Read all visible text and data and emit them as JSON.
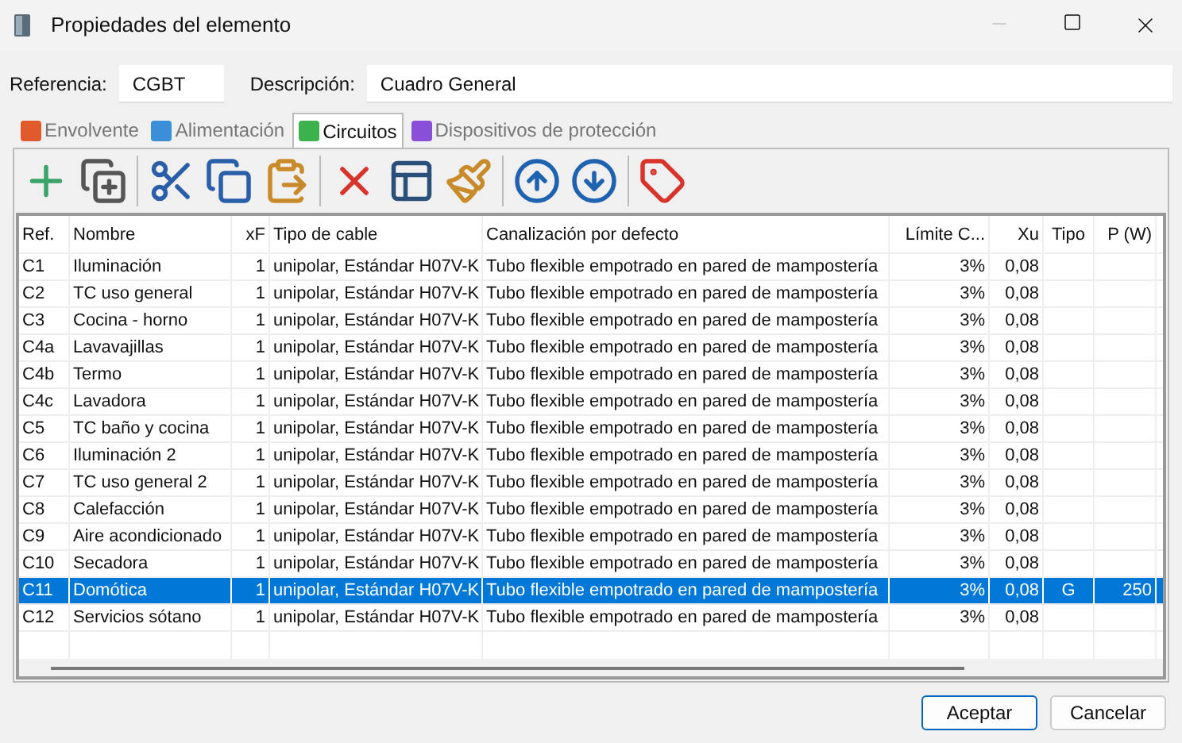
{
  "window": {
    "title": "Propiedades del elemento"
  },
  "fields": [
    {
      "label": "Referencia:",
      "value": "CGBT"
    },
    {
      "label": "Descripción:",
      "value": "Cuadro General"
    }
  ],
  "tabs": [
    {
      "label": "Envolvente",
      "selected": false,
      "color": "#e05a2b"
    },
    {
      "label": "Alimentación",
      "selected": false,
      "color": "#3a8fd8"
    },
    {
      "label": "Circuitos",
      "selected": true,
      "color": "#3cb34a"
    },
    {
      "label": "Dispositivos de protección",
      "selected": false,
      "color": "#8a4fd8"
    }
  ],
  "table": {
    "columns": [
      {
        "label": "Ref."
      },
      {
        "label": "Nombre"
      },
      {
        "label": "xF"
      },
      {
        "label": "Tipo de cable"
      },
      {
        "label": "Canalización por defecto"
      },
      {
        "label": "Límite C..."
      },
      {
        "label": "Xu"
      },
      {
        "label": "Tipo"
      },
      {
        "label": "P (W)"
      }
    ],
    "rows": [
      {
        "selected": false,
        "cells": [
          "C1",
          "Iluminación",
          "1",
          "unipolar, Estándar H07V-K",
          "Tubo flexible empotrado en pared de mampostería",
          "3%",
          "0,08"
        ]
      },
      {
        "selected": false,
        "cells": [
          "C2",
          "TC uso general",
          "1",
          "unipolar, Estándar H07V-K",
          "Tubo flexible empotrado en pared de mampostería",
          "3%",
          "0,08"
        ]
      },
      {
        "selected": false,
        "cells": [
          "C3",
          "Cocina - horno",
          "1",
          "unipolar, Estándar H07V-K",
          "Tubo flexible empotrado en pared de mampostería",
          "3%",
          "0,08"
        ]
      },
      {
        "selected": false,
        "cells": [
          "C4a",
          "Lavavajillas",
          "1",
          "unipolar, Estándar H07V-K",
          "Tubo flexible empotrado en pared de mampostería",
          "3%",
          "0,08"
        ]
      },
      {
        "selected": false,
        "cells": [
          "C4b",
          "Termo",
          "1",
          "unipolar, Estándar H07V-K",
          "Tubo flexible empotrado en pared de mampostería",
          "3%",
          "0,08"
        ]
      },
      {
        "selected": false,
        "cells": [
          "C4c",
          "Lavadora",
          "1",
          "unipolar, Estándar H07V-K",
          "Tubo flexible empotrado en pared de mampostería",
          "3%",
          "0,08"
        ]
      },
      {
        "selected": false,
        "cells": [
          "C5",
          "TC baño y cocina",
          "1",
          "unipolar, Estándar H07V-K",
          "Tubo flexible empotrado en pared de mampostería",
          "3%",
          "0,08"
        ]
      },
      {
        "selected": false,
        "cells": [
          "C6",
          "Iluminación 2",
          "1",
          "unipolar, Estándar H07V-K",
          "Tubo flexible empotrado en pared de mampostería",
          "3%",
          "0,08"
        ]
      },
      {
        "selected": false,
        "cells": [
          "C7",
          "TC uso general 2",
          "1",
          "unipolar, Estándar H07V-K",
          "Tubo flexible empotrado en pared de mampostería",
          "3%",
          "0,08"
        ]
      },
      {
        "selected": false,
        "cells": [
          "C8",
          "Calefacción",
          "1",
          "unipolar, Estándar H07V-K",
          "Tubo flexible empotrado en pared de mampostería",
          "3%",
          "0,08"
        ]
      },
      {
        "selected": false,
        "cells": [
          "C9",
          "Aire acondicionado",
          "1",
          "unipolar, Estándar H07V-K",
          "Tubo flexible empotrado en pared de mampostería",
          "3%",
          "0,08"
        ]
      },
      {
        "selected": false,
        "cells": [
          "C10",
          "Secadora",
          "1",
          "unipolar, Estándar H07V-K",
          "Tubo flexible empotrado en pared de mampostería",
          "3%",
          "0,08"
        ]
      },
      {
        "selected": true,
        "cells": [
          "C11",
          "Domótica",
          "1",
          "unipolar, Estándar H07V-K",
          "Tubo flexible empotrado en pared de mampostería",
          "3%",
          "0,08",
          "G",
          "250"
        ]
      },
      {
        "selected": false,
        "cells": [
          "C12",
          "Servicios sótano",
          "1",
          "unipolar, Estándar H07V-K",
          "Tubo flexible empotrado en pared de mampostería",
          "3%",
          "0,08"
        ]
      }
    ]
  },
  "buttons": [
    {
      "label": "Aceptar",
      "kind": "primary"
    },
    {
      "label": "Cancelar",
      "kind": "secondary"
    }
  ]
}
